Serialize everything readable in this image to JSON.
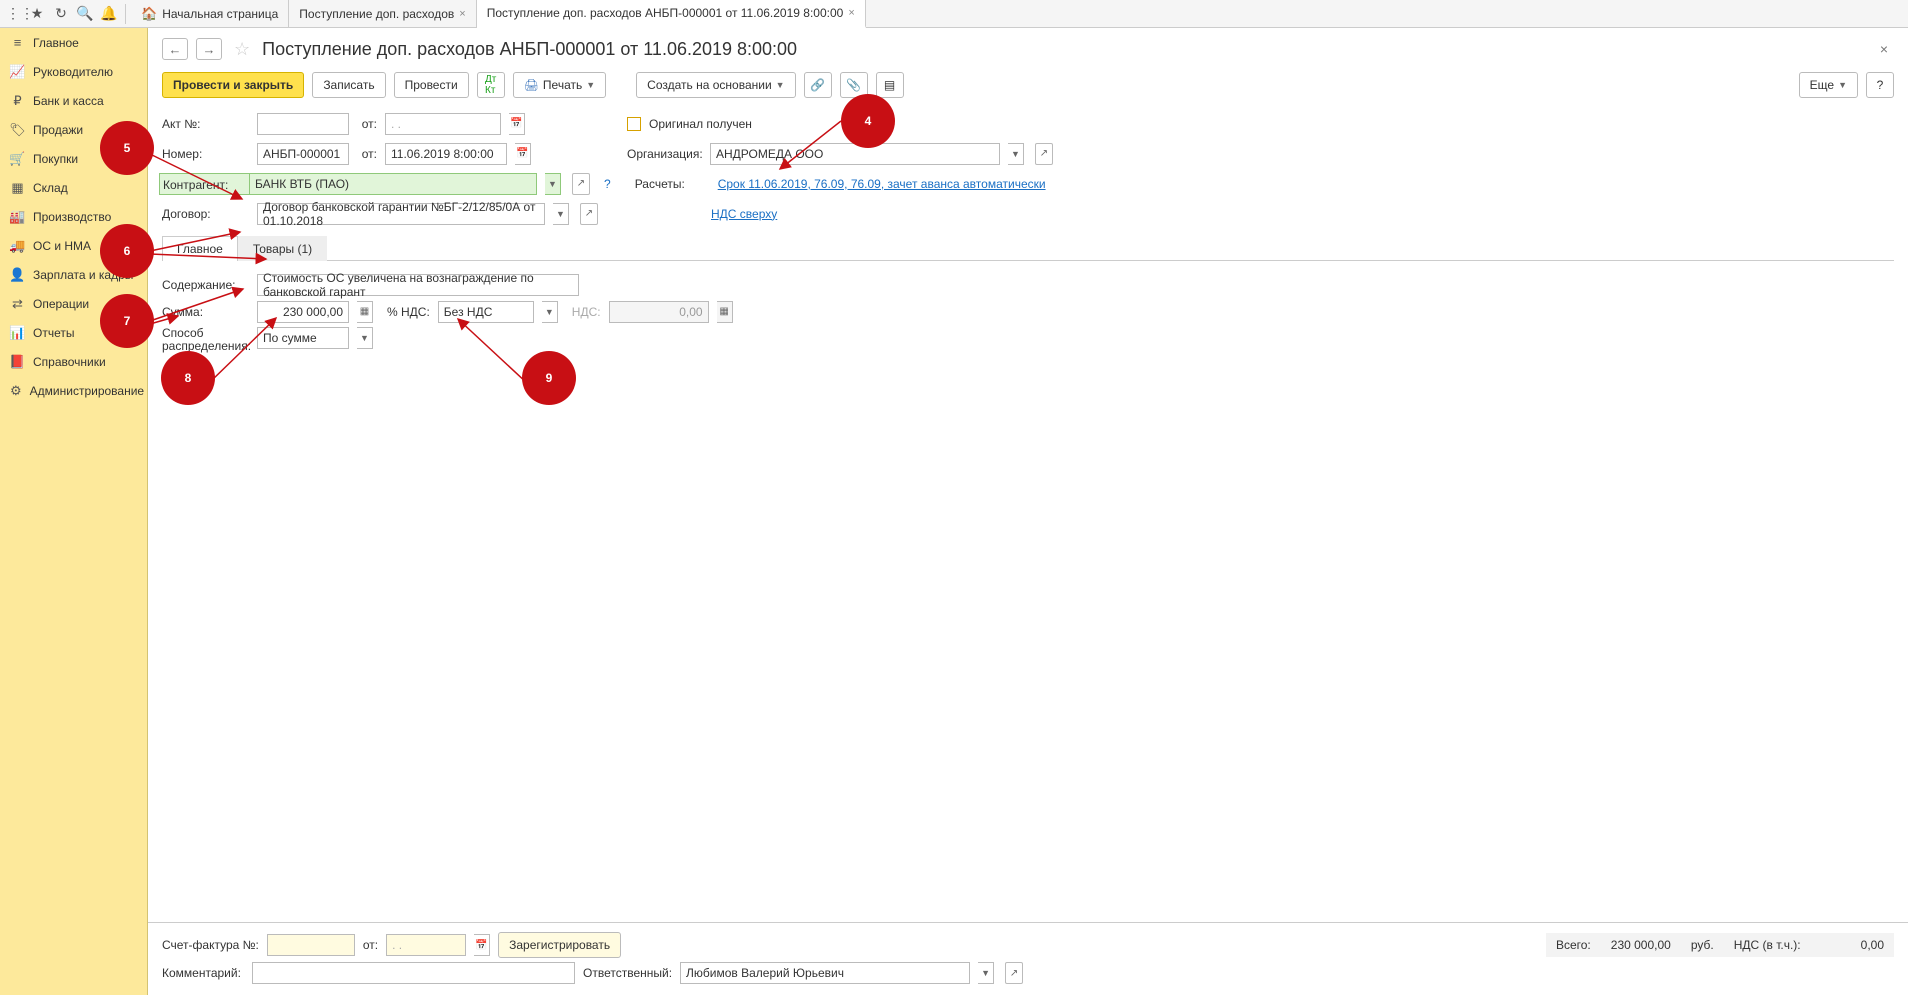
{
  "tabs": {
    "home": "Начальная страница",
    "t1": "Поступление доп. расходов",
    "t2": "Поступление доп. расходов АНБП-000001 от 11.06.2019 8:00:00"
  },
  "sidebar": {
    "items": [
      {
        "label": "Главное"
      },
      {
        "label": "Руководителю"
      },
      {
        "label": "Банк и касса"
      },
      {
        "label": "Продажи"
      },
      {
        "label": "Покупки"
      },
      {
        "label": "Склад"
      },
      {
        "label": "Производство"
      },
      {
        "label": "ОС и НМА"
      },
      {
        "label": "Зарплата и кадры"
      },
      {
        "label": "Операции"
      },
      {
        "label": "Отчеты"
      },
      {
        "label": "Справочники"
      },
      {
        "label": "Администрирование"
      }
    ]
  },
  "header": {
    "title": "Поступление доп. расходов АНБП-000001 от 11.06.2019 8:00:00"
  },
  "toolbar": {
    "post_close": "Провести и закрыть",
    "write": "Записать",
    "post": "Провести",
    "print": "Печать",
    "create_based": "Создать на основании",
    "more": "Еще",
    "help": "?"
  },
  "form": {
    "act_no_label": "Акт №:",
    "act_no": "",
    "ot": "от:",
    "act_date": " .  .",
    "number_label": "Номер:",
    "number": "АНБП-000001",
    "date": "11.06.2019  8:00:00",
    "original_received": "Оригинал получен",
    "org_label": "Организация:",
    "org": "АНДРОМЕДА ООО",
    "contr_label": "Контрагент:",
    "contr": "БАНК ВТБ (ПАО)",
    "contr_q": "?",
    "calc_label": "Расчеты:",
    "calc_link": "Срок 11.06.2019, 76.09, 76.09, зачет аванса автоматически",
    "contract_label": "Договор:",
    "contract": "Договор банковской гарантии №БГ-2/12/85/0А от 01.10.2018",
    "nds_link": "НДС сверху"
  },
  "tabpane": {
    "main": "Главное",
    "goods": "Товары (1)",
    "content_label": "Содержание:",
    "content": "Стоимость ОС увеличена на вознаграждение по банковской гарант",
    "sum_label": "Сумма:",
    "sum": "230 000,00",
    "pct_nds_label": "% НДС:",
    "pct_nds": "Без НДС",
    "nds_label": "НДС:",
    "nds": "0,00",
    "dist_label": "Способ",
    "dist_label2": "распределения:",
    "dist": "По сумме"
  },
  "footer": {
    "sf_label": "Счет-фактура №:",
    "sf": "",
    "sf_ot": "от:",
    "sf_date": " .  .",
    "register": "Зарегистрировать",
    "total_label": "Всего:",
    "total": "230 000,00",
    "currency": "руб.",
    "nds_incl_label": "НДС (в т.ч.):",
    "nds_incl": "0,00",
    "comment_label": "Комментарий:",
    "comment": "",
    "resp_label": "Ответственный:",
    "resp": "Любимов Валерий Юрьевич"
  },
  "markers": {
    "m4": "4",
    "m5": "5",
    "m6": "6",
    "m7": "7",
    "m8": "8",
    "m9": "9"
  }
}
